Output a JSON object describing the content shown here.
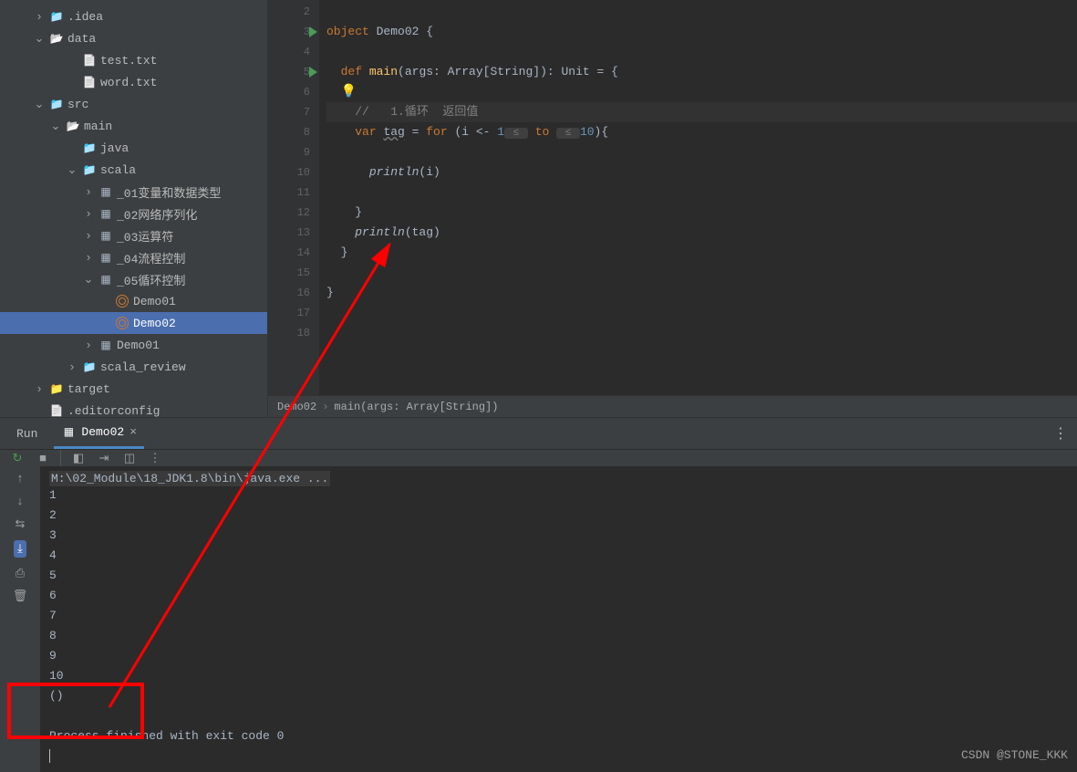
{
  "tree": [
    {
      "indent": 2,
      "chev": ">",
      "icon": "folder-blue",
      "label": ".idea"
    },
    {
      "indent": 2,
      "chev": "v",
      "icon": "folder-open",
      "label": "data"
    },
    {
      "indent": 4,
      "chev": "",
      "icon": "file",
      "label": "test.txt"
    },
    {
      "indent": 4,
      "chev": "",
      "icon": "file",
      "label": "word.txt"
    },
    {
      "indent": 2,
      "chev": "v",
      "icon": "folder-blue",
      "label": "src"
    },
    {
      "indent": 3,
      "chev": "v",
      "icon": "folder-open",
      "label": "main"
    },
    {
      "indent": 4,
      "chev": "",
      "icon": "folder-blue",
      "label": "java"
    },
    {
      "indent": 4,
      "chev": "v",
      "icon": "folder-blue",
      "label": "scala"
    },
    {
      "indent": 5,
      "chev": ">",
      "icon": "pkg",
      "label": "_01变量和数据类型"
    },
    {
      "indent": 5,
      "chev": ">",
      "icon": "pkg",
      "label": "_02网络序列化"
    },
    {
      "indent": 5,
      "chev": ">",
      "icon": "pkg",
      "label": "_03运算符"
    },
    {
      "indent": 5,
      "chev": ">",
      "icon": "pkg",
      "label": "_04流程控制"
    },
    {
      "indent": 5,
      "chev": "v",
      "icon": "pkg",
      "label": "_05循环控制"
    },
    {
      "indent": 6,
      "chev": "",
      "icon": "scala",
      "label": "Demo01"
    },
    {
      "indent": 6,
      "chev": "",
      "icon": "scala",
      "label": "Demo02",
      "sel": true
    },
    {
      "indent": 5,
      "chev": ">",
      "icon": "pkg",
      "label": "Demo01"
    },
    {
      "indent": 4,
      "chev": ">",
      "icon": "folder-blue",
      "label": "scala_review"
    },
    {
      "indent": 2,
      "chev": ">",
      "icon": "folder-orange",
      "label": "target"
    },
    {
      "indent": 2,
      "chev": "",
      "icon": "file",
      "label": ".editorconfig"
    }
  ],
  "gutter": {
    "start": 2,
    "end": 18,
    "run": [
      3,
      5
    ]
  },
  "code": {
    "l2": "",
    "l3": {
      "kw": "object",
      "name": "Demo02",
      "brace": "{"
    },
    "l4": "",
    "l5": {
      "kw1": "def",
      "fn": "main",
      "args": "(args: Array[String]): ",
      "type": "Unit",
      "eq": " = {"
    },
    "l6_bulb": "💡",
    "l7_cmt": "//   1.循环  返回值",
    "l8": {
      "kw1": "var",
      "id": "tag",
      "eq": " = ",
      "kw2": "for",
      "open": " (i <- ",
      "n1": "1",
      "hint1": " ≤ ",
      "kw3": "to",
      "hint2": " ≤ ",
      "n2": "10",
      "close": "){"
    },
    "l9": "",
    "l10": {
      "fn": "println",
      "args": "(i)"
    },
    "l11": "",
    "l12": "    }",
    "l13": {
      "fn": "println",
      "args": "(tag)"
    },
    "l14": "  }",
    "l15": "",
    "l16": "}",
    "l17": "",
    "l18": ""
  },
  "breadcrumb": {
    "a": "Demo02",
    "b": "main(args: Array[String])"
  },
  "run": {
    "label": "Run",
    "tab": "Demo02",
    "cmd": "M:\\02_Module\\18_JDK1.8\\bin\\java.exe ...",
    "output": [
      "1",
      "2",
      "3",
      "4",
      "5",
      "6",
      "7",
      "8",
      "9",
      "10",
      "()"
    ],
    "exit": "Process finished with exit code 0"
  },
  "watermark": "CSDN @STONE_KKK"
}
